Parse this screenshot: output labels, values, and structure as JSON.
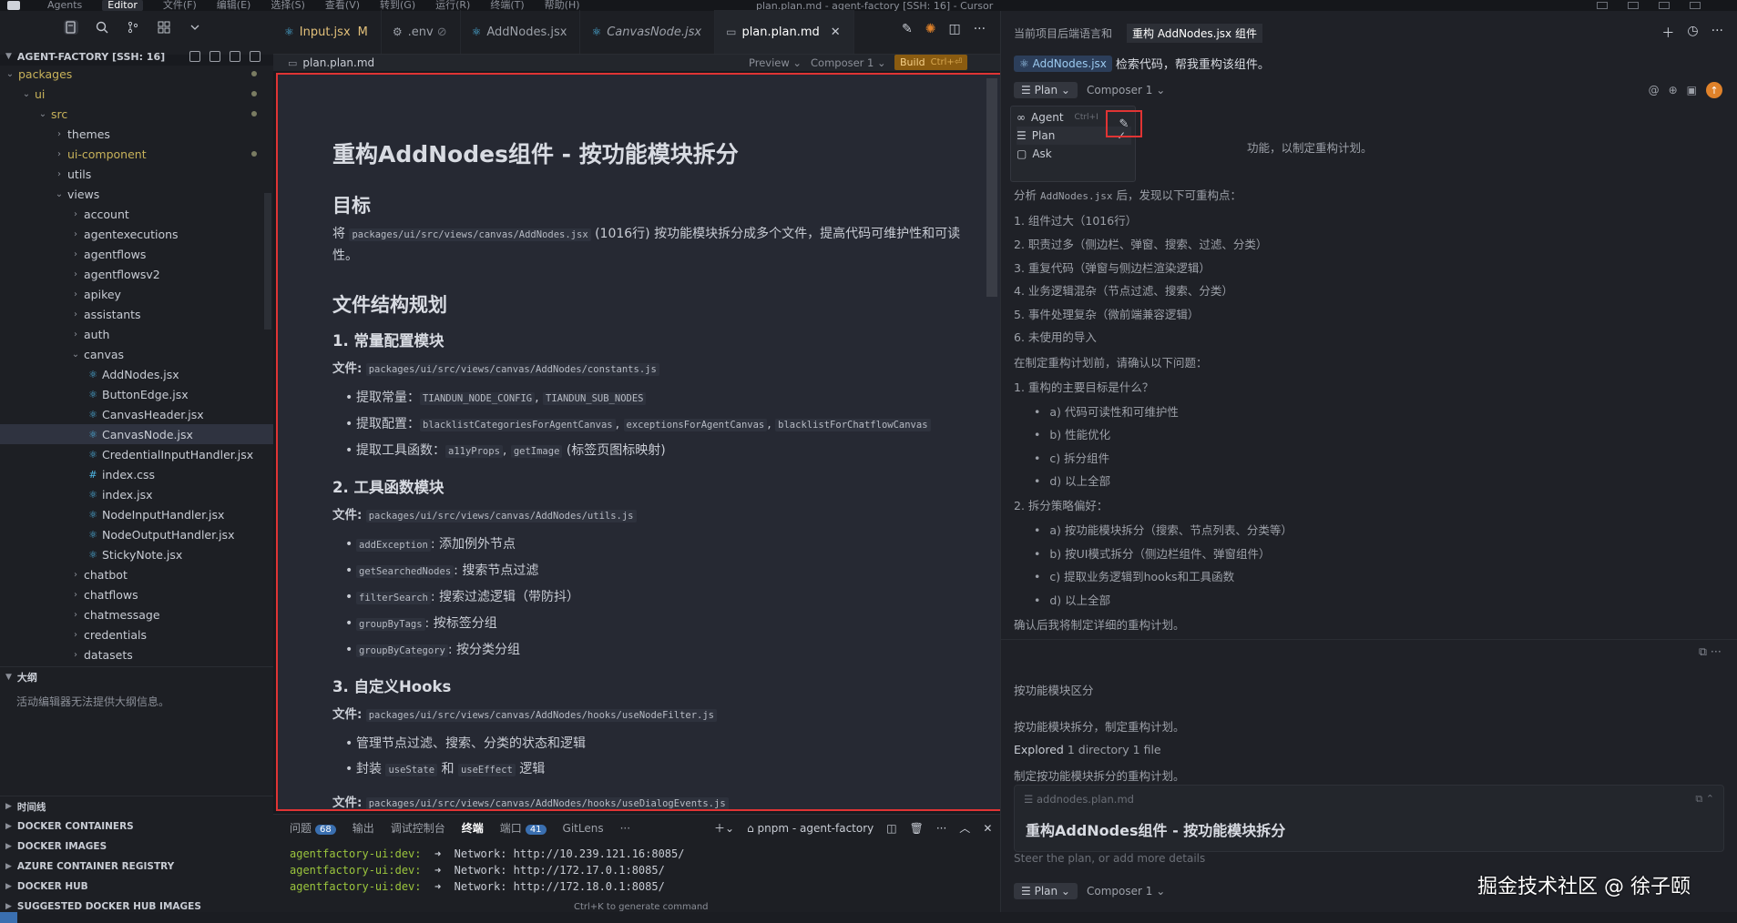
{
  "menubar": {
    "items": [
      "Agents",
      "Editor",
      "文件(F)",
      "编辑(E)",
      "选择(S)",
      "查看(V)",
      "转到(G)",
      "运行(R)",
      "终端(T)",
      "帮助(H)"
    ],
    "active_index": 1,
    "window_title": "plan.plan.md - agent-factory [SSH: 16] - Cursor"
  },
  "explorer": {
    "title": "AGENT-FACTORY [SSH: 16]",
    "tree": [
      {
        "label": "packages",
        "depth": 0,
        "type": "folder",
        "open": true,
        "modified": true
      },
      {
        "label": "ui",
        "depth": 1,
        "type": "folder",
        "open": true,
        "modified": true
      },
      {
        "label": "src",
        "depth": 2,
        "type": "folder",
        "open": true,
        "modified": true
      },
      {
        "label": "themes",
        "depth": 3,
        "type": "folder",
        "open": false
      },
      {
        "label": "ui-component",
        "depth": 3,
        "type": "folder",
        "open": false,
        "modified": true
      },
      {
        "label": "utils",
        "depth": 3,
        "type": "folder",
        "open": false
      },
      {
        "label": "views",
        "depth": 3,
        "type": "folder",
        "open": true
      },
      {
        "label": "account",
        "depth": 4,
        "type": "folder",
        "open": false
      },
      {
        "label": "agentexecutions",
        "depth": 4,
        "type": "folder",
        "open": false
      },
      {
        "label": "agentflows",
        "depth": 4,
        "type": "folder",
        "open": false
      },
      {
        "label": "agentflowsv2",
        "depth": 4,
        "type": "folder",
        "open": false
      },
      {
        "label": "apikey",
        "depth": 4,
        "type": "folder",
        "open": false
      },
      {
        "label": "assistants",
        "depth": 4,
        "type": "folder",
        "open": false
      },
      {
        "label": "auth",
        "depth": 4,
        "type": "folder",
        "open": false
      },
      {
        "label": "canvas",
        "depth": 4,
        "type": "folder",
        "open": true
      },
      {
        "label": "AddNodes.jsx",
        "depth": 5,
        "type": "react"
      },
      {
        "label": "ButtonEdge.jsx",
        "depth": 5,
        "type": "react"
      },
      {
        "label": "CanvasHeader.jsx",
        "depth": 5,
        "type": "react"
      },
      {
        "label": "CanvasNode.jsx",
        "depth": 5,
        "type": "react",
        "selected": true
      },
      {
        "label": "CredentialInputHandler.jsx",
        "depth": 5,
        "type": "react"
      },
      {
        "label": "index.css",
        "depth": 5,
        "type": "css"
      },
      {
        "label": "index.jsx",
        "depth": 5,
        "type": "react"
      },
      {
        "label": "NodeInputHandler.jsx",
        "depth": 5,
        "type": "react"
      },
      {
        "label": "NodeOutputHandler.jsx",
        "depth": 5,
        "type": "react"
      },
      {
        "label": "StickyNote.jsx",
        "depth": 5,
        "type": "react"
      },
      {
        "label": "chatbot",
        "depth": 4,
        "type": "folder",
        "open": false
      },
      {
        "label": "chatflows",
        "depth": 4,
        "type": "folder",
        "open": false
      },
      {
        "label": "chatmessage",
        "depth": 4,
        "type": "folder",
        "open": false
      },
      {
        "label": "credentials",
        "depth": 4,
        "type": "folder",
        "open": false
      },
      {
        "label": "datasets",
        "depth": 4,
        "type": "folder",
        "open": false
      }
    ],
    "outline_title": "大纲",
    "outline_message": "活动编辑器无法提供大纲信息。",
    "sections": [
      "时间线",
      "DOCKER CONTAINERS",
      "DOCKER IMAGES",
      "AZURE CONTAINER REGISTRY",
      "DOCKER HUB",
      "SUGGESTED DOCKER HUB IMAGES"
    ]
  },
  "tabs": [
    {
      "label": "Input.jsx",
      "status": "M",
      "icon": "react-icon",
      "modified": true
    },
    {
      "label": ".env",
      "icon": "gear-icon",
      "dim": "⊘"
    },
    {
      "label": "AddNodes.jsx",
      "icon": "react-icon"
    },
    {
      "label": "CanvasNode.jsx",
      "icon": "react-icon",
      "italic": true
    },
    {
      "label": "plan.plan.md",
      "icon": "markdown-icon",
      "active": true
    }
  ],
  "editor_bar": {
    "filename": "plan.plan.md",
    "preview_label": "Preview",
    "composer_label": "Composer 1",
    "build_label": "Build",
    "build_shortcut": "Ctrl+⏎"
  },
  "doc": {
    "h1": "重构AddNodes组件 - 按功能模块拆分",
    "goal_heading": "目标",
    "goal_prefix": "将 ",
    "goal_code": "packages/ui/src/views/canvas/AddNodes.jsx",
    "goal_suffix": " (1016行) 按功能模块拆分成多个文件，提高代码可维护性和可读性。",
    "structure_heading": "文件结构规划",
    "file_label": "文件:",
    "s1_heading": "1. 常量配置模块",
    "s1_file": "packages/ui/src/views/canvas/AddNodes/constants.js",
    "s1_items": [
      {
        "text": "提取常量：",
        "codes": [
          "TIANDUN_NODE_CONFIG",
          "TIANDUN_SUB_NODES"
        ],
        "tail": ""
      },
      {
        "text": "提取配置：",
        "codes": [
          "blacklistCategoriesForAgentCanvas",
          "exceptionsForAgentCanvas",
          "blacklistForChatflowCanvas"
        ],
        "tail": ""
      },
      {
        "text": "提取工具函数：",
        "codes": [
          "a11yProps",
          "getImage"
        ],
        "tail": " (标签页图标映射)"
      }
    ],
    "s2_heading": "2. 工具函数模块",
    "s2_file": "packages/ui/src/views/canvas/AddNodes/utils.js",
    "s2_items": [
      {
        "code": "addException",
        "text": ": 添加例外节点"
      },
      {
        "code": "getSearchedNodes",
        "text": ": 搜索节点过滤"
      },
      {
        "code": "filterSearch",
        "text": ": 搜索过滤逻辑（带防抖）"
      },
      {
        "code": "groupByTags",
        "text": ": 按标签分组"
      },
      {
        "code": "groupByCategory",
        "text": ": 按分类分组"
      }
    ],
    "s3_heading": "3. 自定义Hooks",
    "s3_file": "packages/ui/src/views/canvas/AddNodes/hooks/useNodeFilter.js",
    "s3_items": [
      {
        "text": "管理节点过滤、搜索、分类的状态和逻辑"
      },
      {
        "text": "封装 ",
        "codes": [
          "useState"
        ],
        "mid": " 和 ",
        "codes2": [
          "useEffect"
        ],
        "tail": " 逻辑"
      }
    ],
    "s4_file": "packages/ui/src/views/canvas/AddNodes/hooks/useDialogEvents.js"
  },
  "panel": {
    "tabs": [
      {
        "label": "问题",
        "badge": "68"
      },
      {
        "label": "输出"
      },
      {
        "label": "调试控制台"
      },
      {
        "label": "终端",
        "active": true
      },
      {
        "label": "端口",
        "badge": "41"
      },
      {
        "label": "GitLens"
      },
      {
        "label": "···"
      }
    ],
    "terminal_name": "pnpm - agent-factory",
    "lines": [
      {
        "host": "agentfactory-ui:dev:",
        "text": "  ➜  Network: http://10.239.121.16:8085/"
      },
      {
        "host": "agentfactory-ui:dev:",
        "text": "  ➜  Network: http://172.17.0.1:8085/"
      },
      {
        "host": "agentfactory-ui:dev:",
        "text": "  ➜  Network: http://172.18.0.1:8085/"
      }
    ],
    "hint": "Ctrl+K to generate command"
  },
  "chat": {
    "tab_inactive": "当前项目后端语言和",
    "tab_active": "重构 AddNodes.jsx 组件",
    "chip": "AddNodes.jsx",
    "user_message": "检索代码，帮我重构该组件。",
    "mode_label": "Plan",
    "composer_label": "Composer 1",
    "modes": [
      {
        "label": "Agent",
        "shortcut": "Ctrl+I",
        "icon": "infinity-icon"
      },
      {
        "label": "Plan",
        "icon": "list-icon",
        "selected": true
      },
      {
        "label": "Ask",
        "icon": "chat-icon"
      }
    ],
    "partial_line": "功能，以制定重构计划。",
    "analysis_prefix": "分析 ",
    "analysis_code": "AddNodes.jsx",
    "analysis_suffix": " 后，发现以下可重构点：",
    "points": [
      "1. 组件过大（1016行）",
      "2. 职责过多（侧边栏、弹窗、搜索、过滤、分类）",
      "3. 重复代码（弹窗与侧边栏渲染逻辑）",
      "4. 业务逻辑混杂（节点过滤、搜索、分类）",
      "5. 事件处理复杂（微前端兼容逻辑）",
      "6. 未使用的导入"
    ],
    "confirm_intro": "在制定重构计划前，请确认以下问题：",
    "q1": "1. 重构的主要目标是什么？",
    "q1_opts": [
      "a) 代码可读性和可维护性",
      "b) 性能优化",
      "c) 拆分组件",
      "d) 以上全部"
    ],
    "q2": "2. 拆分策略偏好：",
    "q2_opts": [
      "a) 按功能模块拆分（搜索、节点列表、分类等）",
      "b) 按UI模式拆分（侧边栏组件、弹窗组件）",
      "c) 提取业务逻辑到hooks和工具函数",
      "d) 以上全部"
    ],
    "confirm_end": "确认后我将制定详细的重构计划。",
    "user_reply": "按功能模块区分",
    "assistant_reply": "按功能模块拆分，制定重构计划。",
    "explored_label": "Explored",
    "explored_detail": "1 directory 1 file",
    "planning_line": "制定按功能模块拆分的重构计划。",
    "plan_card_name": "addnodes.plan.md",
    "plan_card_title": "重构AddNodes组件 - 按功能模块拆分",
    "steer_placeholder": "Steer the plan, or add more details",
    "watermark": "掘金技术社区 @ 徐子颐"
  }
}
